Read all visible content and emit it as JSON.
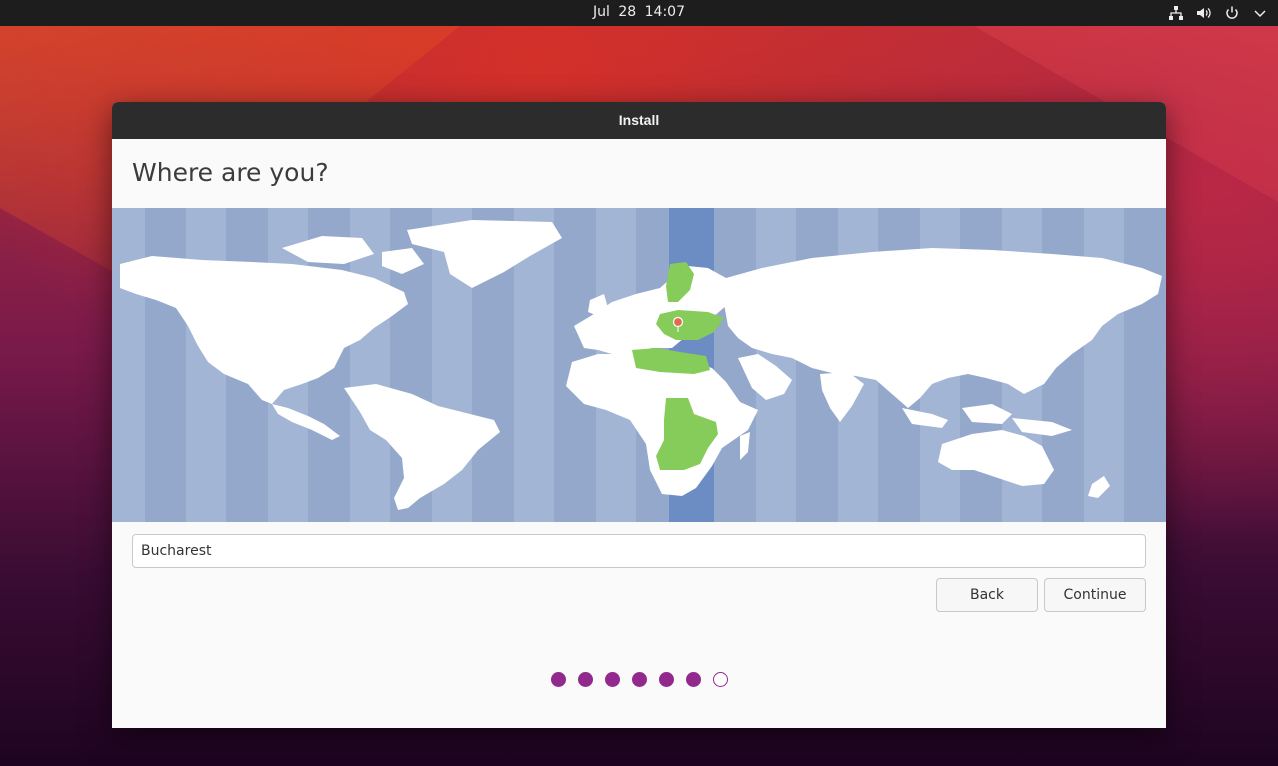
{
  "topbar": {
    "date": "Jul 28",
    "time": "14:07",
    "tray_icons": [
      "network-icon",
      "volume-icon",
      "power-icon",
      "chevron-down-icon"
    ]
  },
  "window": {
    "title": "Install",
    "heading": "Where are you?",
    "city_value": "Bucharest",
    "back_label": "Back",
    "continue_label": "Continue"
  },
  "progress": {
    "total_steps": 7,
    "completed_steps": 6
  },
  "colors": {
    "accent": "#922a8e",
    "map_water": "#94a8cb",
    "map_land": "#ffffff",
    "selected_timezone": "#86cc5a",
    "selected_band": "#6c8cc4"
  }
}
